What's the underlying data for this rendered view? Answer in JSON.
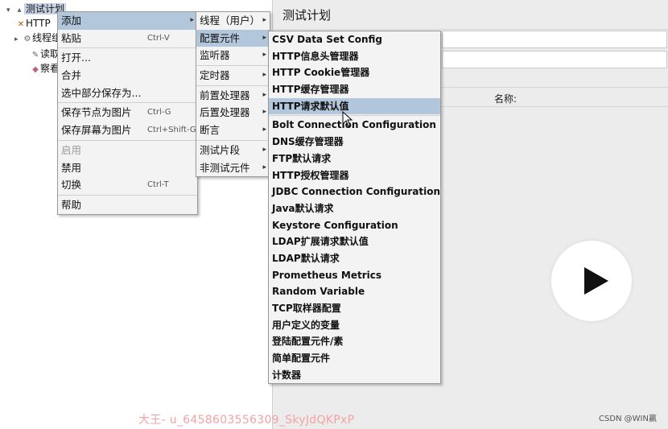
{
  "tree": {
    "root": "测试计划",
    "items": [
      {
        "label": "HTTP"
      },
      {
        "label": "线程组"
      },
      {
        "label": "读取"
      },
      {
        "label": "察看"
      }
    ]
  },
  "right_panel": {
    "title": "测试计划",
    "name_label": "名称:"
  },
  "context_menu": {
    "items": [
      {
        "label": "添加",
        "shortcut": "",
        "submenu": true,
        "selected": true
      },
      {
        "label": "粘贴",
        "shortcut": "Ctrl-V"
      },
      {
        "label": "打开..."
      },
      {
        "label": "合并"
      },
      {
        "label": "选中部分保存为..."
      },
      {
        "label": "保存节点为图片",
        "shortcut": "Ctrl-G"
      },
      {
        "label": "保存屏幕为图片",
        "shortcut": "Ctrl+Shift-G"
      },
      {
        "label": "启用",
        "disabled": true
      },
      {
        "label": "禁用"
      },
      {
        "label": "切换",
        "shortcut": "Ctrl-T"
      },
      {
        "label": "帮助"
      }
    ]
  },
  "add_submenu": {
    "items": [
      {
        "label": "线程（用户）"
      },
      {
        "label": "配置元件",
        "selected": true
      },
      {
        "label": "监听器"
      },
      {
        "label": "定时器"
      },
      {
        "label": "前置处理器"
      },
      {
        "label": "后置处理器"
      },
      {
        "label": "断言"
      },
      {
        "label": "测试片段"
      },
      {
        "label": "非测试元件"
      }
    ]
  },
  "config_submenu": {
    "items": [
      "CSV Data Set Config",
      "HTTP信息头管理器",
      "HTTP Cookie管理器",
      "HTTP缓存管理器",
      "HTTP请求默认值",
      "Bolt Connection Configuration",
      "DNS缓存管理器",
      "FTP默认请求",
      "HTTP授权管理器",
      "JDBC Connection Configuration",
      "Java默认请求",
      "Keystore Configuration",
      "LDAP扩展请求默认值",
      "LDAP默认请求",
      "Prometheus Metrics",
      "Random Variable",
      "TCP取样器配置",
      "用户定义的变量",
      "登陆配置元件/素",
      "简单配置元件",
      "计数器"
    ],
    "selected_index": 4
  },
  "watermarks": {
    "user": "大王- u_6458603556309_SkyJdQKPxP",
    "site": "CSDN @WIN赢"
  },
  "icons": {
    "play": "play-icon",
    "cursor": "mouse-pointer-icon"
  }
}
